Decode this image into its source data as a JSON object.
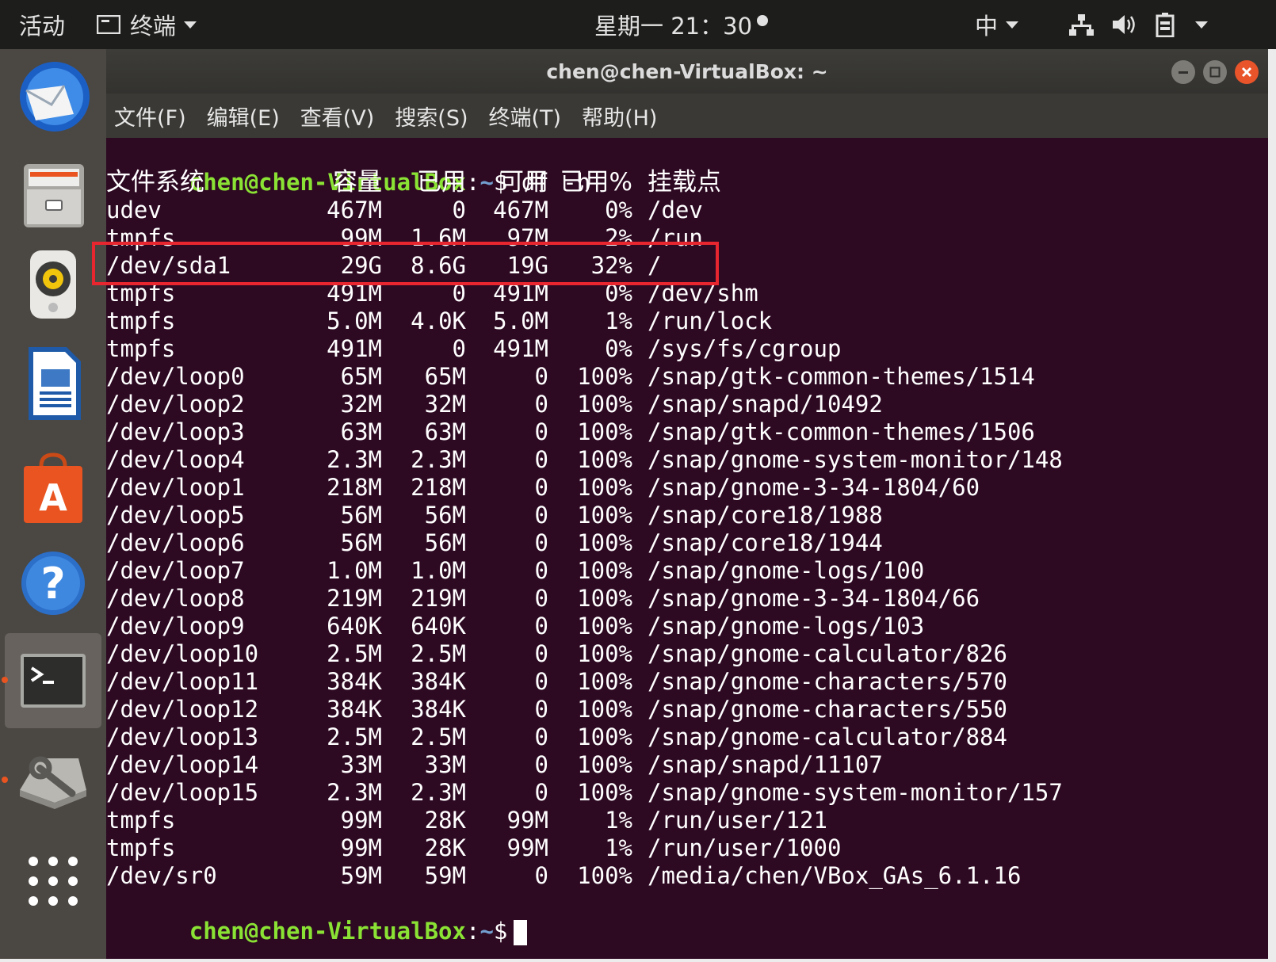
{
  "topbar": {
    "activities": "活动",
    "app_name": "终端",
    "clock": "星期一 21：30",
    "input_method": "中"
  },
  "window": {
    "title": "chen@chen-VirtualBox: ~"
  },
  "menu": [
    "文件(F)",
    "编辑(E)",
    "查看(V)",
    "搜索(S)",
    "终端(T)",
    "帮助(H)"
  ],
  "terminal": {
    "prompt_user": "chen@chen-VirtualBox",
    "prompt_path": "~",
    "prompt_symbol": "$",
    "command": "df -h",
    "header": [
      "文件系统",
      "容量",
      "已用",
      "可用",
      "已用%",
      "挂载点"
    ],
    "rows": [
      [
        "udev",
        "467M",
        "0",
        "467M",
        "0%",
        "/dev"
      ],
      [
        "tmpfs",
        "99M",
        "1.6M",
        "97M",
        "2%",
        "/run"
      ],
      [
        "/dev/sda1",
        "29G",
        "8.6G",
        "19G",
        "32%",
        "/"
      ],
      [
        "tmpfs",
        "491M",
        "0",
        "491M",
        "0%",
        "/dev/shm"
      ],
      [
        "tmpfs",
        "5.0M",
        "4.0K",
        "5.0M",
        "1%",
        "/run/lock"
      ],
      [
        "tmpfs",
        "491M",
        "0",
        "491M",
        "0%",
        "/sys/fs/cgroup"
      ],
      [
        "/dev/loop0",
        "65M",
        "65M",
        "0",
        "100%",
        "/snap/gtk-common-themes/1514"
      ],
      [
        "/dev/loop2",
        "32M",
        "32M",
        "0",
        "100%",
        "/snap/snapd/10492"
      ],
      [
        "/dev/loop3",
        "63M",
        "63M",
        "0",
        "100%",
        "/snap/gtk-common-themes/1506"
      ],
      [
        "/dev/loop4",
        "2.3M",
        "2.3M",
        "0",
        "100%",
        "/snap/gnome-system-monitor/148"
      ],
      [
        "/dev/loop1",
        "218M",
        "218M",
        "0",
        "100%",
        "/snap/gnome-3-34-1804/60"
      ],
      [
        "/dev/loop5",
        "56M",
        "56M",
        "0",
        "100%",
        "/snap/core18/1988"
      ],
      [
        "/dev/loop6",
        "56M",
        "56M",
        "0",
        "100%",
        "/snap/core18/1944"
      ],
      [
        "/dev/loop7",
        "1.0M",
        "1.0M",
        "0",
        "100%",
        "/snap/gnome-logs/100"
      ],
      [
        "/dev/loop8",
        "219M",
        "219M",
        "0",
        "100%",
        "/snap/gnome-3-34-1804/66"
      ],
      [
        "/dev/loop9",
        "640K",
        "640K",
        "0",
        "100%",
        "/snap/gnome-logs/103"
      ],
      [
        "/dev/loop10",
        "2.5M",
        "2.5M",
        "0",
        "100%",
        "/snap/gnome-calculator/826"
      ],
      [
        "/dev/loop11",
        "384K",
        "384K",
        "0",
        "100%",
        "/snap/gnome-characters/570"
      ],
      [
        "/dev/loop12",
        "384K",
        "384K",
        "0",
        "100%",
        "/snap/gnome-characters/550"
      ],
      [
        "/dev/loop13",
        "2.5M",
        "2.5M",
        "0",
        "100%",
        "/snap/gnome-calculator/884"
      ],
      [
        "/dev/loop14",
        "33M",
        "33M",
        "0",
        "100%",
        "/snap/snapd/11107"
      ],
      [
        "/dev/loop15",
        "2.3M",
        "2.3M",
        "0",
        "100%",
        "/snap/gnome-system-monitor/157"
      ],
      [
        "tmpfs",
        "99M",
        "28K",
        "99M",
        "1%",
        "/run/user/121"
      ],
      [
        "tmpfs",
        "99M",
        "28K",
        "99M",
        "1%",
        "/run/user/1000"
      ],
      [
        "/dev/sr0",
        "59M",
        "59M",
        "0",
        "100%",
        "/media/chen/VBox_GAs_6.1.16"
      ]
    ]
  },
  "dock": [
    {
      "icon": "thunderbird-icon"
    },
    {
      "icon": "files-icon"
    },
    {
      "icon": "rhythmbox-icon"
    },
    {
      "icon": "writer-icon"
    },
    {
      "icon": "software-icon"
    },
    {
      "icon": "help-icon"
    },
    {
      "icon": "terminal-icon"
    },
    {
      "icon": "settings-icon"
    },
    {
      "icon": "apps-grid-icon"
    }
  ],
  "colors": {
    "terminal_bg": "#2d0922",
    "prompt_green": "#8ae234",
    "path_blue": "#729fcf",
    "highlight_red": "#e8262f",
    "accent_orange": "#e95420"
  }
}
